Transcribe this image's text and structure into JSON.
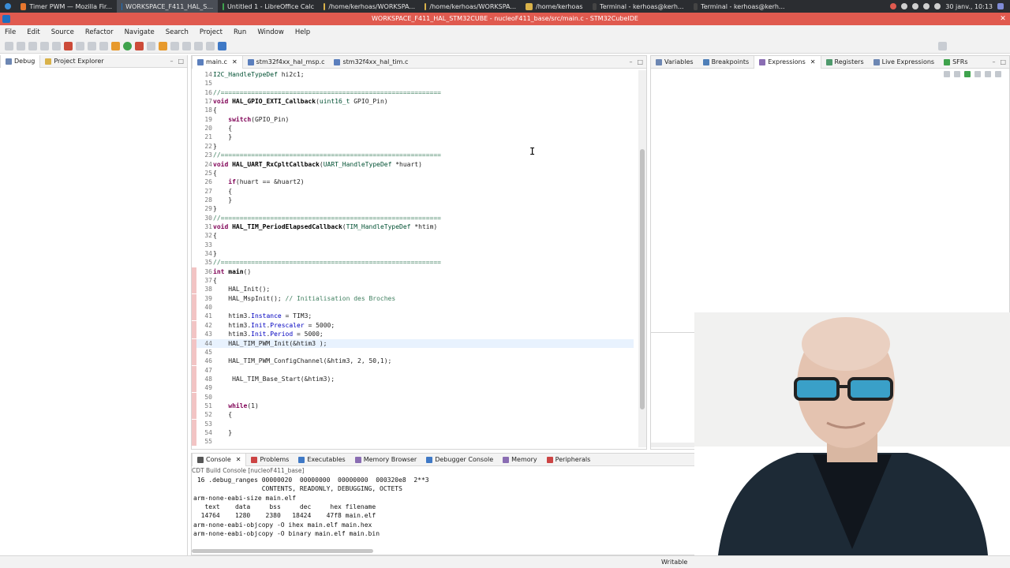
{
  "taskbar": {
    "tasks": [
      {
        "label": "Timer PWM — Mozilla Fir...",
        "icon": "firefox-icon",
        "color": "#e8772e"
      },
      {
        "label": "WORKSPACE_F411_HAL_S...",
        "icon": "ide-icon",
        "color": "#1d6fc0",
        "active": true
      },
      {
        "label": "Untitled 1 - LibreOffice Calc",
        "icon": "calc-icon",
        "color": "#3fa34d"
      },
      {
        "label": "/home/kerhoas/WORKSPA...",
        "icon": "folder-icon",
        "color": "#d9b24a"
      },
      {
        "label": "/home/kerhoas/WORKSPA...",
        "icon": "folder-icon",
        "color": "#d9b24a"
      },
      {
        "label": "/home/kerhoas",
        "icon": "folder-icon",
        "color": "#d9b24a"
      },
      {
        "label": "Terminal - kerhoas@kerh...",
        "icon": "terminal-icon",
        "color": "#444"
      },
      {
        "label": "Terminal - kerhoas@kerh...",
        "icon": "terminal-icon",
        "color": "#444"
      }
    ],
    "clock": "30 janv., 10:13"
  },
  "window": {
    "title": "WORKSPACE_F411_HAL_STM32CUBE - nucleoF411_base/src/main.c - STM32CubeIDE"
  },
  "menu": [
    "File",
    "Edit",
    "Source",
    "Refactor",
    "Navigate",
    "Search",
    "Project",
    "Run",
    "Window",
    "Help"
  ],
  "left_panel": {
    "tabs": [
      "Debug",
      "Project Explorer"
    ]
  },
  "editor": {
    "tabs": [
      "main.c",
      "stm32f4xx_hal_msp.c",
      "stm32f4xx_hal_tim.c"
    ],
    "lines": [
      {
        "n": "14",
        "text": "I2C_HandleTypeDef hi2c1;"
      },
      {
        "n": "15",
        "text": ""
      },
      {
        "n": "16",
        "text": "//=========================================================="
      },
      {
        "n": "17",
        "text": "void HAL_GPIO_EXTI_Callback(uint16_t GPIO_Pin)"
      },
      {
        "n": "18",
        "text": "{"
      },
      {
        "n": "19",
        "text": "    switch(GPIO_Pin)"
      },
      {
        "n": "20",
        "text": "    {"
      },
      {
        "n": "21",
        "text": "    }"
      },
      {
        "n": "22",
        "text": "}"
      },
      {
        "n": "23",
        "text": "//=========================================================="
      },
      {
        "n": "24",
        "text": "void HAL_UART_RxCpltCallback(UART_HandleTypeDef *huart)"
      },
      {
        "n": "25",
        "text": "{"
      },
      {
        "n": "26",
        "text": "    if(huart == &huart2)"
      },
      {
        "n": "27",
        "text": "    {"
      },
      {
        "n": "28",
        "text": "    }"
      },
      {
        "n": "29",
        "text": "}"
      },
      {
        "n": "30",
        "text": "//=========================================================="
      },
      {
        "n": "31",
        "text": "void HAL_TIM_PeriodElapsedCallback(TIM_HandleTypeDef *htim)"
      },
      {
        "n": "32",
        "text": "{"
      },
      {
        "n": "33",
        "text": ""
      },
      {
        "n": "34",
        "text": "}"
      },
      {
        "n": "35",
        "text": "//=========================================================="
      },
      {
        "n": "36",
        "text": "int main()"
      },
      {
        "n": "37",
        "text": "{"
      },
      {
        "n": "38",
        "text": "    HAL_Init();"
      },
      {
        "n": "39",
        "text": "    HAL_MspInit(); // Initialisation des Broches"
      },
      {
        "n": "40",
        "text": ""
      },
      {
        "n": "41",
        "text": "    htim3.Instance = TIM3;"
      },
      {
        "n": "42",
        "text": "    htim3.Init.Prescaler = 5000;"
      },
      {
        "n": "43",
        "text": "    htim3.Init.Period = 5000;"
      },
      {
        "n": "44",
        "text": "    HAL_TIM_PWM_Init(&htim3 );"
      },
      {
        "n": "45",
        "text": ""
      },
      {
        "n": "46",
        "text": "    HAL_TIM_PWM_ConfigChannel(&htim3, 2, 50,1);"
      },
      {
        "n": "47",
        "text": ""
      },
      {
        "n": "48",
        "text": "     HAL_TIM_Base_Start(&htim3);"
      },
      {
        "n": "49",
        "text": ""
      },
      {
        "n": "50",
        "text": ""
      },
      {
        "n": "51",
        "text": "    while(1)"
      },
      {
        "n": "52",
        "text": "    {"
      },
      {
        "n": "53",
        "text": ""
      },
      {
        "n": "54",
        "text": "    }"
      },
      {
        "n": "55",
        "text": ""
      }
    ]
  },
  "right_panel": {
    "tabs": [
      "Variables",
      "Breakpoints",
      "Expressions",
      "Registers",
      "Live Expressions",
      "SFRs"
    ]
  },
  "console": {
    "tabs": [
      "Console",
      "Problems",
      "Executables",
      "Memory Browser",
      "Debugger Console",
      "Memory",
      "Peripherals"
    ],
    "label": "CDT Build Console [nucleoF411_base]",
    "text": " 16 .debug_ranges 00000020  00000000  00000000  000320e8  2**3\n                  CONTENTS, READONLY, DEBUGGING, OCTETS\narm-none-eabi-size main.elf\n   text    data     bss     dec     hex filename\n  14764    1280    2380   18424    47f8 main.elf\narm-none-eabi-objcopy -O ihex main.elf main.hex\narm-none-eabi-objcopy -O binary main.elf main.bin"
  },
  "status": {
    "mode": "Writable"
  }
}
